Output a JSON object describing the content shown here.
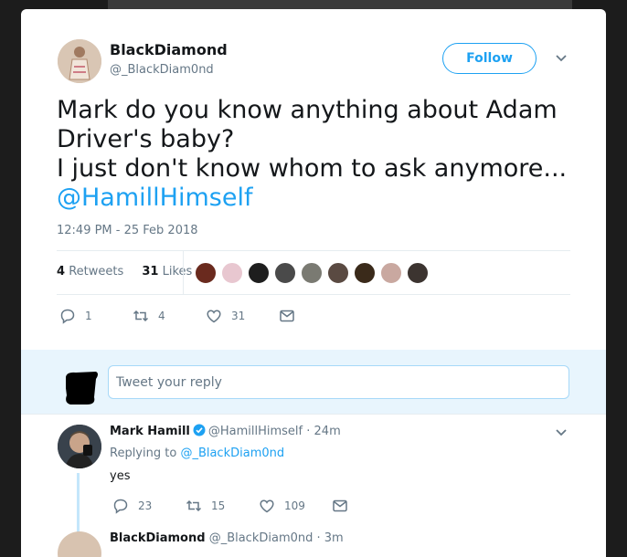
{
  "tweet": {
    "author_name": "BlackDiamond",
    "author_handle": "@_BlackDiam0nd",
    "follow_label": "Follow",
    "text_line1": "Mark do you know anything about Adam",
    "text_line2": "Driver's baby?",
    "text_line3": "I just don't know whom to ask anymore...",
    "mention": "@HamillHimself",
    "timestamp": "12:49 PM - 25 Feb 2018",
    "retweets_count": "4",
    "retweets_label": "Retweets",
    "likes_count": "31",
    "likes_label": "Likes",
    "actions": {
      "replies": "1",
      "retweets": "4",
      "likes": "31"
    }
  },
  "reply_box": {
    "placeholder": "Tweet your reply"
  },
  "reply": {
    "author_name": "Mark Hamill",
    "author_handle": "@HamillHimself",
    "time": "· 24m",
    "replying_prefix": "Replying to",
    "replying_to": "@_BlackDiam0nd",
    "text": "yes",
    "actions": {
      "replies": "23",
      "retweets": "15",
      "likes": "109"
    }
  },
  "next_tweet": {
    "author_name": "BlackDiamond",
    "author_handle": "@_BlackDiam0nd · 3m"
  },
  "colors": {
    "accent": "#1da1f2",
    "muted": "#657786",
    "reply_bg": "#e8f5fd"
  },
  "icons": [
    "caret-down-icon",
    "reply-icon",
    "retweet-icon",
    "heart-icon",
    "dm-icon",
    "verified-icon"
  ]
}
